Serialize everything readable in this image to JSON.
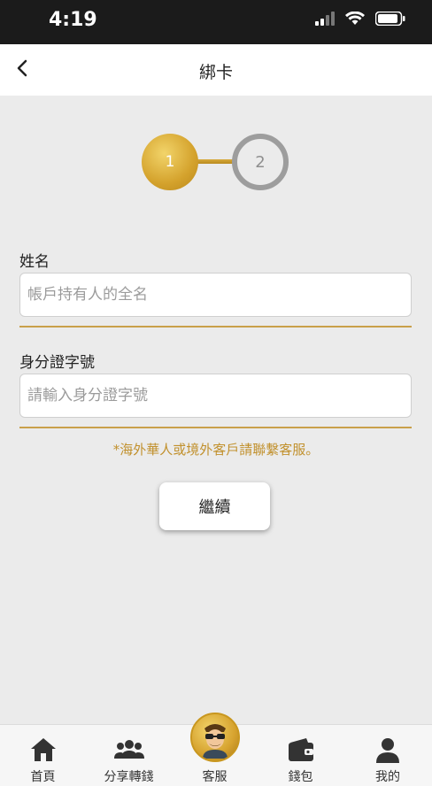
{
  "status_bar": {
    "time": "4:19"
  },
  "nav": {
    "title": "綁卡"
  },
  "stepper": {
    "step1": "1",
    "step2": "2",
    "current": 1
  },
  "form": {
    "name_label": "姓名",
    "name_placeholder": "帳戶持有人的全名",
    "name_value": "",
    "id_label": "身分證字號",
    "id_placeholder": "請輸入身分證字號",
    "id_value": "",
    "notice": "*海外華人或境外客戶請聯繫客服。",
    "continue_label": "繼續"
  },
  "tab_bar": {
    "items": [
      {
        "label": "首頁",
        "icon": "home-icon"
      },
      {
        "label": "分享轉錢",
        "icon": "group-icon"
      },
      {
        "label": "客服",
        "icon": "support-avatar-icon"
      },
      {
        "label": "錢包",
        "icon": "wallet-icon"
      },
      {
        "label": "我的",
        "icon": "person-icon"
      }
    ]
  },
  "colors": {
    "accent_gold": "#c9a04a",
    "notice_gold": "#c1902c",
    "status_bar": "#1b1b1b"
  }
}
